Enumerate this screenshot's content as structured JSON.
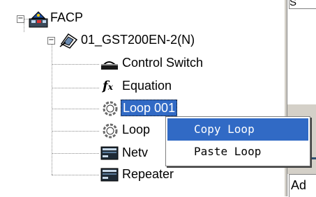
{
  "tree": {
    "root_label": "FACP",
    "child_label": "01_GST200EN-2(N)",
    "items": [
      {
        "label": "Control Switch",
        "icon": "control-switch-icon"
      },
      {
        "label": "Equation",
        "icon": "equation-fx-icon"
      },
      {
        "label": "Loop 001",
        "icon": "loop-ring-icon",
        "selected": true
      },
      {
        "label": "Loop",
        "icon": "loop-ring-icon"
      },
      {
        "label": "Netv",
        "icon": "network-icon"
      },
      {
        "label": "Repeater",
        "icon": "repeater-icon"
      }
    ],
    "expander_symbol": "−"
  },
  "context_menu": {
    "items": [
      {
        "label": "Copy Loop",
        "highlighted": true
      },
      {
        "label": "Paste Loop",
        "highlighted": false
      }
    ]
  },
  "right_pane": {
    "top_text": "S",
    "bottom_text": "Ad"
  },
  "colors": {
    "selection_blue": "#316ac5",
    "panel_grey": "#d4d0c8"
  }
}
